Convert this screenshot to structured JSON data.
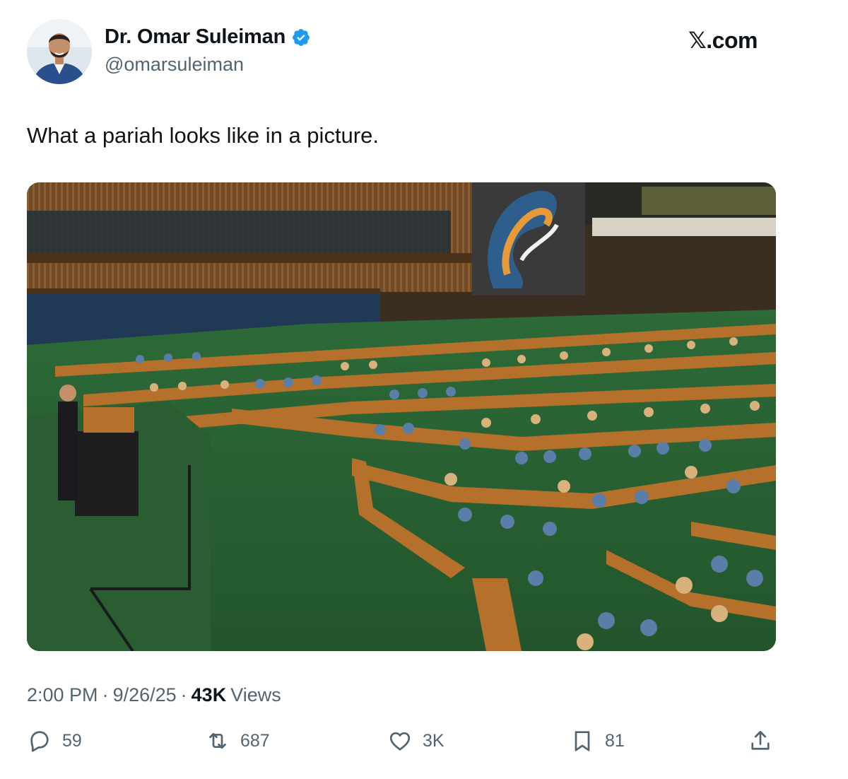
{
  "author": {
    "display_name": "Dr. Omar Suleiman",
    "handle": "@omarsuleiman",
    "verified": true,
    "verified_color": "#1d9bf0",
    "avatar_icon": "profile-photo"
  },
  "site": {
    "label": "𝕏.com"
  },
  "tweet": {
    "text": "What a pariah looks like in a picture.",
    "media_icon": "photo-general-assembly-hall"
  },
  "meta": {
    "time": "2:00 PM",
    "sep1": "·",
    "date": "9/26/25",
    "sep2": "·",
    "views_count": "43K",
    "views_label": "Views"
  },
  "actions": {
    "reply": {
      "icon": "reply-icon",
      "count": "59"
    },
    "repost": {
      "icon": "repost-icon",
      "count": "687"
    },
    "like": {
      "icon": "heart-icon",
      "count": "3K"
    },
    "bookmark": {
      "icon": "bookmark-icon",
      "count": "81"
    },
    "share": {
      "icon": "share-icon"
    }
  },
  "colors": {
    "text": "#0f1419",
    "secondary": "#536471",
    "floor_green": "#2f6b3a",
    "desk_wood": "#b5712c",
    "seat_blue": "#5a7ea8",
    "seat_tan": "#d9b17c"
  }
}
